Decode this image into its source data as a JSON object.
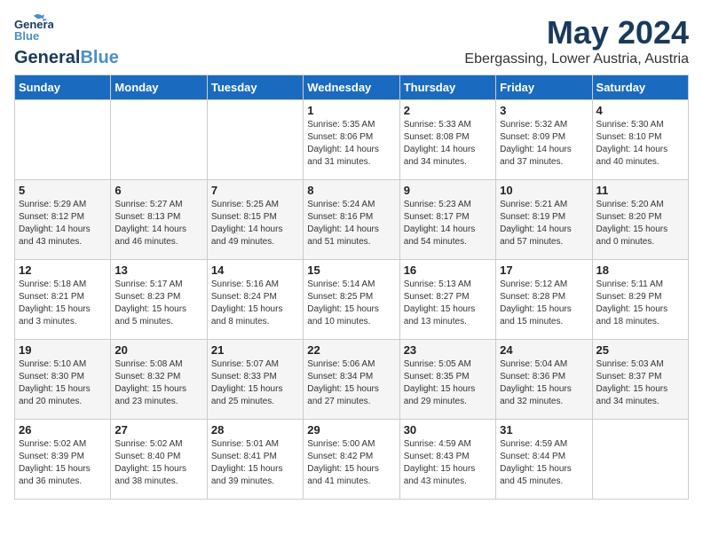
{
  "header": {
    "logo_general": "General",
    "logo_blue": "Blue",
    "month_title": "May 2024",
    "location": "Ebergassing, Lower Austria, Austria"
  },
  "days_of_week": [
    "Sunday",
    "Monday",
    "Tuesday",
    "Wednesday",
    "Thursday",
    "Friday",
    "Saturday"
  ],
  "weeks": [
    [
      {
        "day": "",
        "info": ""
      },
      {
        "day": "",
        "info": ""
      },
      {
        "day": "",
        "info": ""
      },
      {
        "day": "1",
        "info": "Sunrise: 5:35 AM\nSunset: 8:06 PM\nDaylight: 14 hours\nand 31 minutes."
      },
      {
        "day": "2",
        "info": "Sunrise: 5:33 AM\nSunset: 8:08 PM\nDaylight: 14 hours\nand 34 minutes."
      },
      {
        "day": "3",
        "info": "Sunrise: 5:32 AM\nSunset: 8:09 PM\nDaylight: 14 hours\nand 37 minutes."
      },
      {
        "day": "4",
        "info": "Sunrise: 5:30 AM\nSunset: 8:10 PM\nDaylight: 14 hours\nand 40 minutes."
      }
    ],
    [
      {
        "day": "5",
        "info": "Sunrise: 5:29 AM\nSunset: 8:12 PM\nDaylight: 14 hours\nand 43 minutes."
      },
      {
        "day": "6",
        "info": "Sunrise: 5:27 AM\nSunset: 8:13 PM\nDaylight: 14 hours\nand 46 minutes."
      },
      {
        "day": "7",
        "info": "Sunrise: 5:25 AM\nSunset: 8:15 PM\nDaylight: 14 hours\nand 49 minutes."
      },
      {
        "day": "8",
        "info": "Sunrise: 5:24 AM\nSunset: 8:16 PM\nDaylight: 14 hours\nand 51 minutes."
      },
      {
        "day": "9",
        "info": "Sunrise: 5:23 AM\nSunset: 8:17 PM\nDaylight: 14 hours\nand 54 minutes."
      },
      {
        "day": "10",
        "info": "Sunrise: 5:21 AM\nSunset: 8:19 PM\nDaylight: 14 hours\nand 57 minutes."
      },
      {
        "day": "11",
        "info": "Sunrise: 5:20 AM\nSunset: 8:20 PM\nDaylight: 15 hours\nand 0 minutes."
      }
    ],
    [
      {
        "day": "12",
        "info": "Sunrise: 5:18 AM\nSunset: 8:21 PM\nDaylight: 15 hours\nand 3 minutes."
      },
      {
        "day": "13",
        "info": "Sunrise: 5:17 AM\nSunset: 8:23 PM\nDaylight: 15 hours\nand 5 minutes."
      },
      {
        "day": "14",
        "info": "Sunrise: 5:16 AM\nSunset: 8:24 PM\nDaylight: 15 hours\nand 8 minutes."
      },
      {
        "day": "15",
        "info": "Sunrise: 5:14 AM\nSunset: 8:25 PM\nDaylight: 15 hours\nand 10 minutes."
      },
      {
        "day": "16",
        "info": "Sunrise: 5:13 AM\nSunset: 8:27 PM\nDaylight: 15 hours\nand 13 minutes."
      },
      {
        "day": "17",
        "info": "Sunrise: 5:12 AM\nSunset: 8:28 PM\nDaylight: 15 hours\nand 15 minutes."
      },
      {
        "day": "18",
        "info": "Sunrise: 5:11 AM\nSunset: 8:29 PM\nDaylight: 15 hours\nand 18 minutes."
      }
    ],
    [
      {
        "day": "19",
        "info": "Sunrise: 5:10 AM\nSunset: 8:30 PM\nDaylight: 15 hours\nand 20 minutes."
      },
      {
        "day": "20",
        "info": "Sunrise: 5:08 AM\nSunset: 8:32 PM\nDaylight: 15 hours\nand 23 minutes."
      },
      {
        "day": "21",
        "info": "Sunrise: 5:07 AM\nSunset: 8:33 PM\nDaylight: 15 hours\nand 25 minutes."
      },
      {
        "day": "22",
        "info": "Sunrise: 5:06 AM\nSunset: 8:34 PM\nDaylight: 15 hours\nand 27 minutes."
      },
      {
        "day": "23",
        "info": "Sunrise: 5:05 AM\nSunset: 8:35 PM\nDaylight: 15 hours\nand 29 minutes."
      },
      {
        "day": "24",
        "info": "Sunrise: 5:04 AM\nSunset: 8:36 PM\nDaylight: 15 hours\nand 32 minutes."
      },
      {
        "day": "25",
        "info": "Sunrise: 5:03 AM\nSunset: 8:37 PM\nDaylight: 15 hours\nand 34 minutes."
      }
    ],
    [
      {
        "day": "26",
        "info": "Sunrise: 5:02 AM\nSunset: 8:39 PM\nDaylight: 15 hours\nand 36 minutes."
      },
      {
        "day": "27",
        "info": "Sunrise: 5:02 AM\nSunset: 8:40 PM\nDaylight: 15 hours\nand 38 minutes."
      },
      {
        "day": "28",
        "info": "Sunrise: 5:01 AM\nSunset: 8:41 PM\nDaylight: 15 hours\nand 39 minutes."
      },
      {
        "day": "29",
        "info": "Sunrise: 5:00 AM\nSunset: 8:42 PM\nDaylight: 15 hours\nand 41 minutes."
      },
      {
        "day": "30",
        "info": "Sunrise: 4:59 AM\nSunset: 8:43 PM\nDaylight: 15 hours\nand 43 minutes."
      },
      {
        "day": "31",
        "info": "Sunrise: 4:59 AM\nSunset: 8:44 PM\nDaylight: 15 hours\nand 45 minutes."
      },
      {
        "day": "",
        "info": ""
      }
    ]
  ]
}
